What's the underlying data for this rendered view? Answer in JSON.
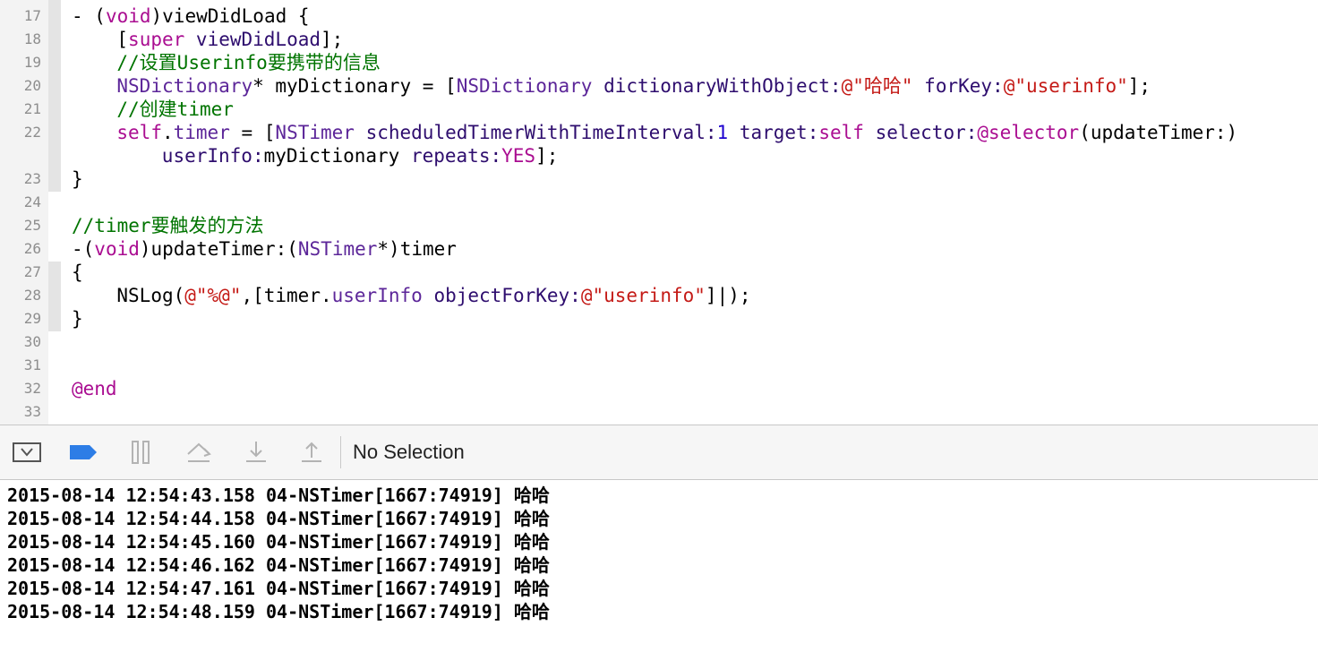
{
  "editor": {
    "lines": [
      {
        "n": "17",
        "indent": 0,
        "tokens": [
          {
            "t": "- (",
            "c": "pl"
          },
          {
            "t": "void",
            "c": "kw"
          },
          {
            "t": ")viewDidLoad {",
            "c": "pl"
          }
        ]
      },
      {
        "n": "18",
        "indent": 4,
        "tokens": [
          {
            "t": "[",
            "c": "pl"
          },
          {
            "t": "super",
            "c": "kw"
          },
          {
            "t": " ",
            "c": "pl"
          },
          {
            "t": "viewDidLoad",
            "c": "meth"
          },
          {
            "t": "];",
            "c": "pl"
          }
        ]
      },
      {
        "n": "19",
        "indent": 4,
        "tokens": [
          {
            "t": "//设置Userinfo要携带的信息",
            "c": "cmt"
          }
        ]
      },
      {
        "n": "20",
        "indent": 4,
        "tokens": [
          {
            "t": "NSDictionary",
            "c": "cls"
          },
          {
            "t": "* myDictionary = [",
            "c": "pl"
          },
          {
            "t": "NSDictionary",
            "c": "cls"
          },
          {
            "t": " ",
            "c": "pl"
          },
          {
            "t": "dictionaryWithObject:",
            "c": "meth"
          },
          {
            "t": "@\"哈哈\"",
            "c": "str"
          },
          {
            "t": " ",
            "c": "pl"
          },
          {
            "t": "forKey:",
            "c": "meth"
          },
          {
            "t": "@\"userinfo\"",
            "c": "str"
          },
          {
            "t": "];",
            "c": "pl"
          }
        ]
      },
      {
        "n": "21",
        "indent": 4,
        "tokens": [
          {
            "t": "//创建timer",
            "c": "cmt"
          }
        ]
      },
      {
        "n": "22",
        "indent": 4,
        "tokens": [
          {
            "t": "self",
            "c": "kw"
          },
          {
            "t": ".",
            "c": "pl"
          },
          {
            "t": "timer",
            "c": "prop"
          },
          {
            "t": " = [",
            "c": "pl"
          },
          {
            "t": "NSTimer",
            "c": "cls"
          },
          {
            "t": " ",
            "c": "pl"
          },
          {
            "t": "scheduledTimerWithTimeInterval:",
            "c": "meth"
          },
          {
            "t": "1",
            "c": "num"
          },
          {
            "t": " ",
            "c": "pl"
          },
          {
            "t": "target:",
            "c": "meth"
          },
          {
            "t": "self",
            "c": "kw"
          },
          {
            "t": " ",
            "c": "pl"
          },
          {
            "t": "selector:",
            "c": "meth"
          },
          {
            "t": "@selector",
            "c": "kw"
          },
          {
            "t": "(updateTimer:)",
            "c": "pl"
          }
        ]
      },
      {
        "n": "",
        "indent": 8,
        "tokens": [
          {
            "t": "userInfo:",
            "c": "meth"
          },
          {
            "t": "myDictionary ",
            "c": "pl"
          },
          {
            "t": "repeats:",
            "c": "meth"
          },
          {
            "t": "YES",
            "c": "kw"
          },
          {
            "t": "];",
            "c": "pl"
          }
        ]
      },
      {
        "n": "23",
        "indent": 0,
        "tokens": [
          {
            "t": "}",
            "c": "pl"
          }
        ]
      },
      {
        "n": "24",
        "indent": 0,
        "tokens": []
      },
      {
        "n": "25",
        "indent": 0,
        "tokens": [
          {
            "t": "//timer要触发的方法",
            "c": "cmt"
          }
        ]
      },
      {
        "n": "26",
        "indent": 0,
        "tokens": [
          {
            "t": "-(",
            "c": "pl"
          },
          {
            "t": "void",
            "c": "kw"
          },
          {
            "t": ")updateTimer:(",
            "c": "pl"
          },
          {
            "t": "NSTimer",
            "c": "cls"
          },
          {
            "t": "*)timer",
            "c": "pl"
          }
        ]
      },
      {
        "n": "27",
        "indent": 0,
        "tokens": [
          {
            "t": "{",
            "c": "pl"
          }
        ]
      },
      {
        "n": "28",
        "indent": 4,
        "tokens": [
          {
            "t": "NSLog(",
            "c": "pl"
          },
          {
            "t": "@\"%@\"",
            "c": "str"
          },
          {
            "t": ",[timer.",
            "c": "pl"
          },
          {
            "t": "userInfo",
            "c": "prop"
          },
          {
            "t": " ",
            "c": "pl"
          },
          {
            "t": "objectForKey:",
            "c": "meth"
          },
          {
            "t": "@\"userinfo\"",
            "c": "str"
          },
          {
            "t": "]",
            "c": "pl"
          },
          {
            "t": "|",
            "c": "caret"
          },
          {
            "t": ");",
            "c": "pl"
          }
        ]
      },
      {
        "n": "29",
        "indent": 0,
        "tokens": [
          {
            "t": "}",
            "c": "pl"
          }
        ]
      },
      {
        "n": "30",
        "indent": 0,
        "tokens": []
      },
      {
        "n": "31",
        "indent": 0,
        "tokens": []
      },
      {
        "n": "32",
        "indent": 0,
        "tokens": [
          {
            "t": "@end",
            "c": "kw"
          }
        ]
      },
      {
        "n": "33",
        "indent": 0,
        "tokens": []
      }
    ]
  },
  "debug_bar": {
    "icons": [
      "hide-debug-area-icon",
      "breakpoints-toggle-icon",
      "pause-icon",
      "step-over-icon",
      "step-into-icon",
      "step-out-icon"
    ],
    "selection_label": "No Selection",
    "breakpoint_color": "#2d7de6"
  },
  "console": {
    "lines": [
      "2015-08-14 12:54:43.158 04-NSTimer[1667:74919] 哈哈",
      "2015-08-14 12:54:44.158 04-NSTimer[1667:74919] 哈哈",
      "2015-08-14 12:54:45.160 04-NSTimer[1667:74919] 哈哈",
      "2015-08-14 12:54:46.162 04-NSTimer[1667:74919] 哈哈",
      "2015-08-14 12:54:47.161 04-NSTimer[1667:74919] 哈哈",
      "2015-08-14 12:54:48.159 04-NSTimer[1667:74919] 哈哈"
    ]
  }
}
